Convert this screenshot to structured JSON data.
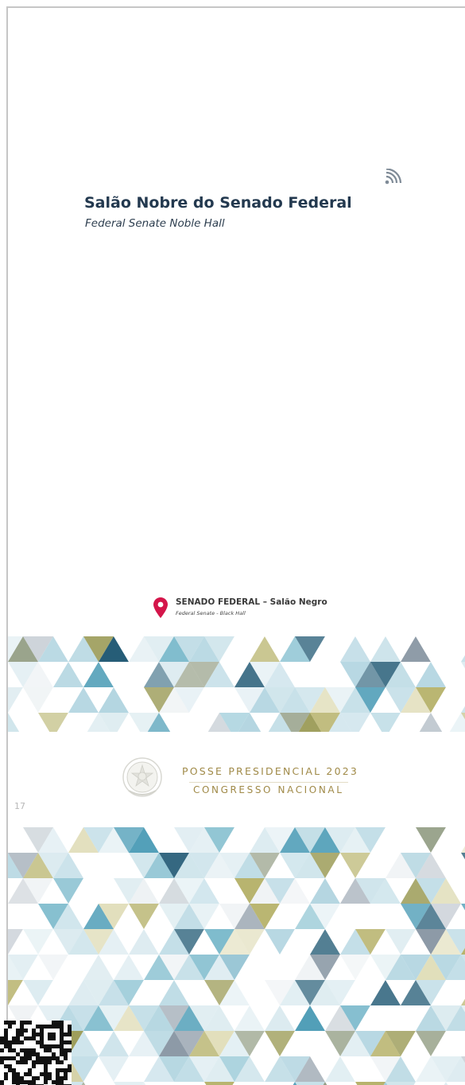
{
  "hall": {
    "title": "Salão Nobre do Senado Federal",
    "subtitle": "Federal Senate Noble Hall"
  },
  "location": {
    "title": "SENADO FEDERAL – Salão Negro",
    "subtitle": "Federal Senate - Black Hall",
    "pin_color": "#d4154a"
  },
  "event": {
    "title": "POSSE PRESIDENCIAL 2023",
    "organization": "CONGRESSO NACIONAL"
  },
  "page_number": "17",
  "icons": [
    "rss-icon",
    "location-pin-icon",
    "coat-of-arms-seal-icon",
    "qr-code"
  ],
  "colors": {
    "title": "#23394f",
    "gold": "#a08a48",
    "pattern": [
      "#1f5873",
      "#4c9cb6",
      "#7fbccd",
      "#b4d6e1",
      "#dcebf0",
      "#7d8a6c",
      "#8a8a3a",
      "#b6b26a",
      "#dedbb4",
      "#8896a3",
      "#c3cbd2",
      "#eef2f4"
    ]
  }
}
